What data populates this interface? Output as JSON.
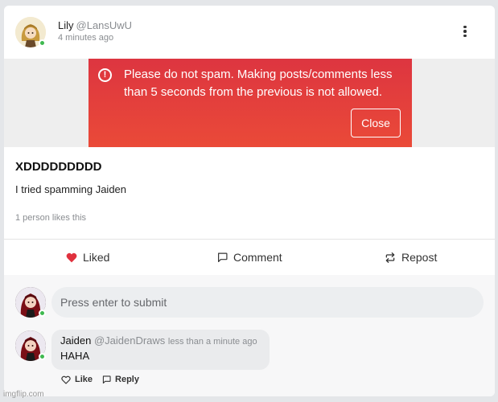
{
  "post": {
    "author_name": "Lily",
    "author_handle": "@LansUwU",
    "time": "4 minutes ago",
    "title": "XDDDDDDDDD",
    "text": "I tried spamming Jaiden",
    "likes_text": "1 person likes this"
  },
  "alert": {
    "icon": "alert-circle-icon",
    "message": "Please do not spam. Making posts/comments less than 5 seconds from the previous is not allowed.",
    "close_label": "Close",
    "color_top": "#dd3540",
    "color_bottom": "#ea4a38"
  },
  "actions": {
    "like_label": "Liked",
    "comment_label": "Comment",
    "repost_label": "Repost",
    "liked_color": "#e0313e"
  },
  "comment_box": {
    "placeholder": "Press enter to submit"
  },
  "comments": [
    {
      "author_name": "Jaiden",
      "author_handle": "@JaidenDraws",
      "time": "less than a minute ago",
      "text": "HAHA",
      "like_label": "Like",
      "reply_label": "Reply"
    }
  ],
  "watermark": "imgflip.com"
}
